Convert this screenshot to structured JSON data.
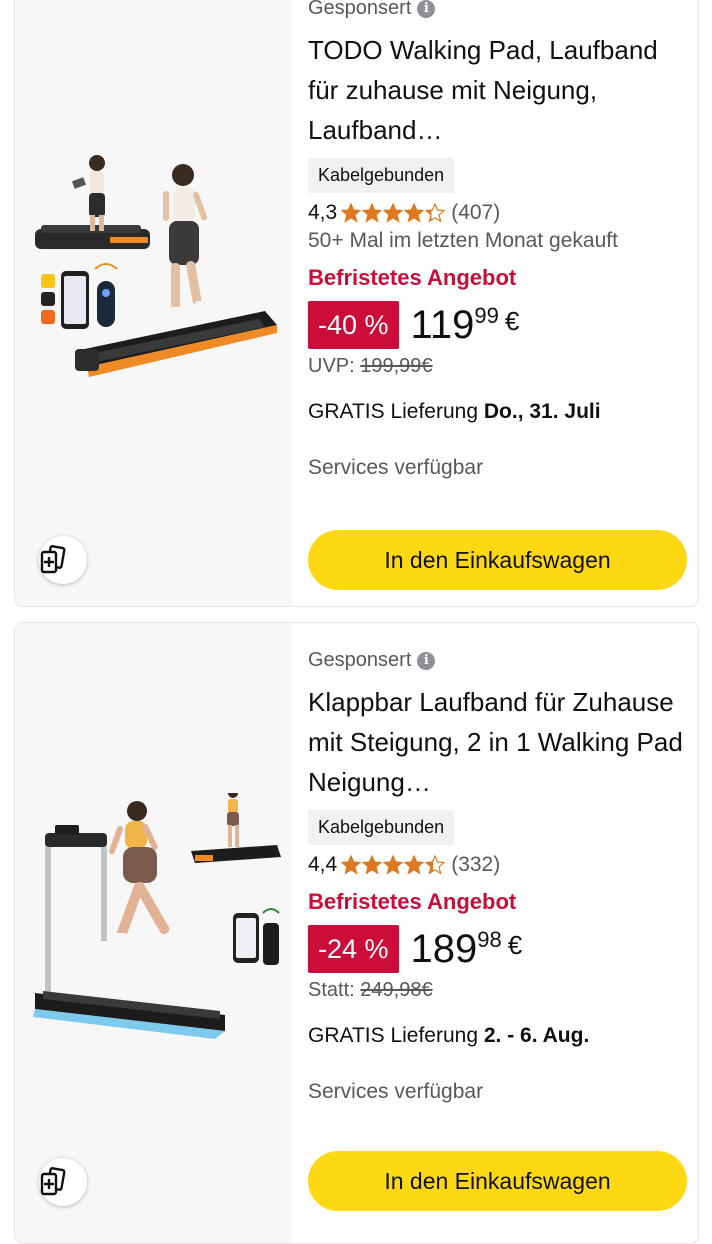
{
  "products": [
    {
      "sponsored": "Gesponsert",
      "title": "TODO Walking Pad, Laufband für zuhause mit Neigung, Laufband…",
      "badge": "Kabelgebunden",
      "rating": "4,3",
      "rating_value": 4.3,
      "review_count": "(407)",
      "bought": "50+ Mal im letzten Monat gekauft",
      "deal": "Befristetes Angebot",
      "discount": "-40 %",
      "price_whole": "119",
      "price_fraction": "99",
      "currency": "€",
      "list_label": "UVP:",
      "list_price": "199,99€",
      "delivery_prefix": "GRATIS Lieferung",
      "delivery_date": "Do., 31. Juli",
      "services": "Services verfügbar",
      "cart_label": "In den Einkaufswagen"
    },
    {
      "sponsored": "Gesponsert",
      "title": "Klappbar Laufband für Zuhause mit Steigung, 2 in 1 Walking Pad Neigung…",
      "badge": "Kabelgebunden",
      "rating": "4,4",
      "rating_value": 4.4,
      "review_count": "(332)",
      "deal": "Befristetes Angebot",
      "discount": "-24 %",
      "price_whole": "189",
      "price_fraction": "98",
      "currency": "€",
      "list_label": "Statt:",
      "list_price": "249,98€",
      "delivery_prefix": "GRATIS Lieferung",
      "delivery_date": "2. - 6. Aug.",
      "services": "Services verfügbar",
      "cart_label": "In den Einkaufswagen"
    }
  ],
  "colors": {
    "deal_red": "#cc0c39",
    "star_orange": "#de7921",
    "cart_yellow": "#ffd814",
    "muted_text": "#565959"
  },
  "icons": {
    "info": "info-icon",
    "star": "star-icon",
    "compare": "compare-icon"
  }
}
